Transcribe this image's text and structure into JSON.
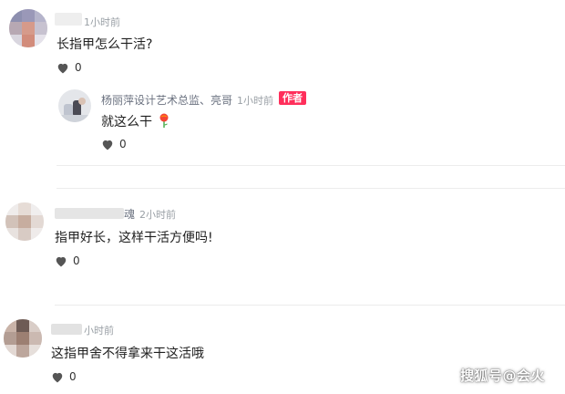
{
  "comments": [
    {
      "time": "1小时前",
      "text": "长指甲怎么干活?",
      "likes": "0",
      "reply": {
        "author": "杨丽萍设计艺术总监、亮哥",
        "time": "1小时前",
        "badge": "作者",
        "text": "就这么干",
        "likes": "0"
      }
    },
    {
      "author_tail": "魂",
      "time": "2小时前",
      "text": "指甲好长，这样干活方便吗!",
      "likes": "0"
    },
    {
      "time": "小时前",
      "text": "这指甲舍不得拿来干这活哦",
      "likes": "0"
    }
  ],
  "watermark": "搜狐号@会火",
  "colors": {
    "badge": "#ff2f5b",
    "heart": "#555555",
    "divider": "#ececec"
  }
}
